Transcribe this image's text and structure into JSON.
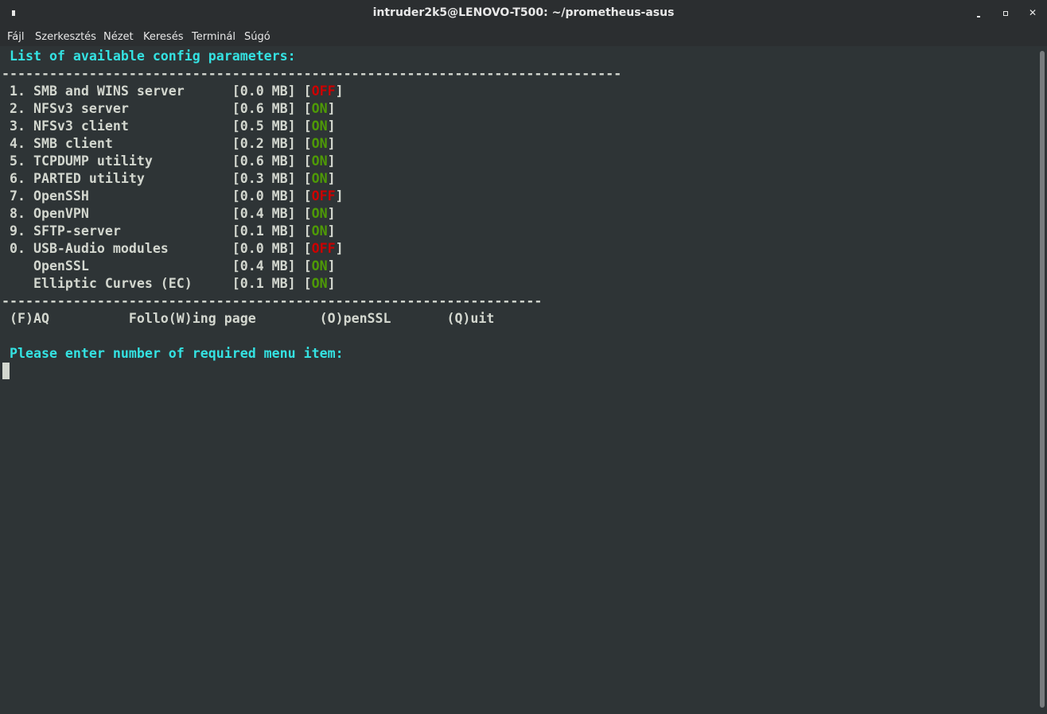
{
  "window": {
    "title": "intruder2k5@LENOVO-T500: ~/prometheus-asus",
    "buttons": {
      "minimize": "",
      "maximize": "",
      "close": "✕"
    }
  },
  "menubar": {
    "items": [
      "Fájl",
      "Szerkesztés",
      "Nézet",
      "Keresés",
      "Terminál",
      "Súgó"
    ]
  },
  "terminal": {
    "heading": " List of available config parameters:",
    "separator_top": "------------------------------------------------------------------------------",
    "params": [
      {
        "prefix": " 1. SMB and WINS server      [0.0 MB] [",
        "status": "OFF",
        "suffix": "]"
      },
      {
        "prefix": " 2. NFSv3 server             [0.6 MB] [",
        "status": "ON",
        "suffix": "]"
      },
      {
        "prefix": " 3. NFSv3 client             [0.5 MB] [",
        "status": "ON",
        "suffix": "]"
      },
      {
        "prefix": " 4. SMB client               [0.2 MB] [",
        "status": "ON",
        "suffix": "]"
      },
      {
        "prefix": " 5. TCPDUMP utility          [0.6 MB] [",
        "status": "ON",
        "suffix": "]"
      },
      {
        "prefix": " 6. PARTED utility           [0.3 MB] [",
        "status": "ON",
        "suffix": "]"
      },
      {
        "prefix": " 7. OpenSSH                  [0.0 MB] [",
        "status": "OFF",
        "suffix": "]"
      },
      {
        "prefix": " 8. OpenVPN                  [0.4 MB] [",
        "status": "ON",
        "suffix": "]"
      },
      {
        "prefix": " 9. SFTP-server              [0.1 MB] [",
        "status": "ON",
        "suffix": "]"
      },
      {
        "prefix": " 0. USB-Audio modules        [0.0 MB] [",
        "status": "OFF",
        "suffix": "]"
      },
      {
        "prefix": "    OpenSSL                  [0.4 MB] [",
        "status": "ON",
        "suffix": "]"
      },
      {
        "prefix": "    Elliptic Curves (EC)     [0.1 MB] [",
        "status": "ON",
        "suffix": "]"
      }
    ],
    "separator_bottom": "--------------------------------------------------------------------",
    "options": " (F)AQ          Follo(W)ing page        (O)penSSL       (Q)uit",
    "prompt": " Please enter number of required menu item:"
  },
  "colors": {
    "background": "#2e3436",
    "text": "#d3d7cf",
    "heading": "#34e2e2",
    "off": "#cc0000",
    "on": "#4e9a06"
  }
}
